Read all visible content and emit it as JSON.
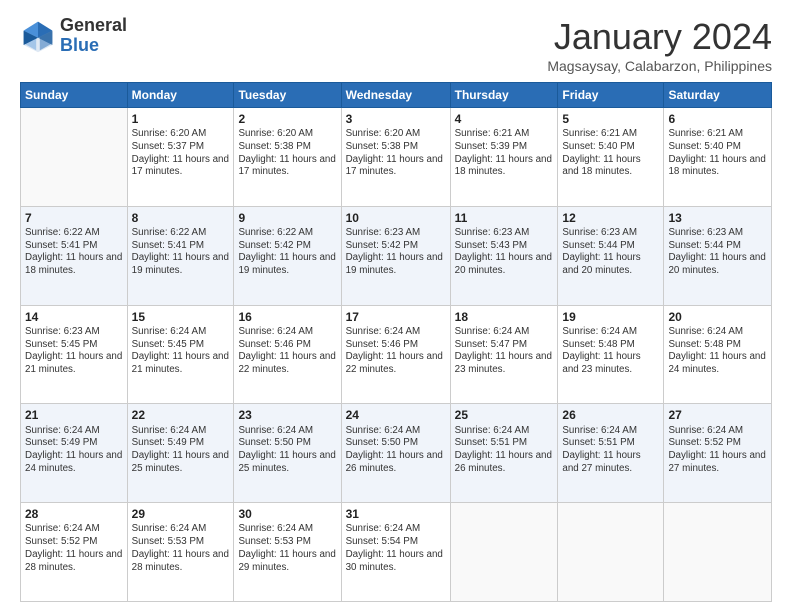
{
  "logo": {
    "general": "General",
    "blue": "Blue"
  },
  "title": "January 2024",
  "location": "Magsaysay, Calabarzon, Philippines",
  "days_header": [
    "Sunday",
    "Monday",
    "Tuesday",
    "Wednesday",
    "Thursday",
    "Friday",
    "Saturday"
  ],
  "weeks": [
    [
      {
        "day": "",
        "sunrise": "",
        "sunset": "",
        "daylight": ""
      },
      {
        "day": "1",
        "sunrise": "Sunrise: 6:20 AM",
        "sunset": "Sunset: 5:37 PM",
        "daylight": "Daylight: 11 hours and 17 minutes."
      },
      {
        "day": "2",
        "sunrise": "Sunrise: 6:20 AM",
        "sunset": "Sunset: 5:38 PM",
        "daylight": "Daylight: 11 hours and 17 minutes."
      },
      {
        "day": "3",
        "sunrise": "Sunrise: 6:20 AM",
        "sunset": "Sunset: 5:38 PM",
        "daylight": "Daylight: 11 hours and 17 minutes."
      },
      {
        "day": "4",
        "sunrise": "Sunrise: 6:21 AM",
        "sunset": "Sunset: 5:39 PM",
        "daylight": "Daylight: 11 hours and 18 minutes."
      },
      {
        "day": "5",
        "sunrise": "Sunrise: 6:21 AM",
        "sunset": "Sunset: 5:40 PM",
        "daylight": "Daylight: 11 hours and 18 minutes."
      },
      {
        "day": "6",
        "sunrise": "Sunrise: 6:21 AM",
        "sunset": "Sunset: 5:40 PM",
        "daylight": "Daylight: 11 hours and 18 minutes."
      }
    ],
    [
      {
        "day": "7",
        "sunrise": "Sunrise: 6:22 AM",
        "sunset": "Sunset: 5:41 PM",
        "daylight": "Daylight: 11 hours and 18 minutes."
      },
      {
        "day": "8",
        "sunrise": "Sunrise: 6:22 AM",
        "sunset": "Sunset: 5:41 PM",
        "daylight": "Daylight: 11 hours and 19 minutes."
      },
      {
        "day": "9",
        "sunrise": "Sunrise: 6:22 AM",
        "sunset": "Sunset: 5:42 PM",
        "daylight": "Daylight: 11 hours and 19 minutes."
      },
      {
        "day": "10",
        "sunrise": "Sunrise: 6:23 AM",
        "sunset": "Sunset: 5:42 PM",
        "daylight": "Daylight: 11 hours and 19 minutes."
      },
      {
        "day": "11",
        "sunrise": "Sunrise: 6:23 AM",
        "sunset": "Sunset: 5:43 PM",
        "daylight": "Daylight: 11 hours and 20 minutes."
      },
      {
        "day": "12",
        "sunrise": "Sunrise: 6:23 AM",
        "sunset": "Sunset: 5:44 PM",
        "daylight": "Daylight: 11 hours and 20 minutes."
      },
      {
        "day": "13",
        "sunrise": "Sunrise: 6:23 AM",
        "sunset": "Sunset: 5:44 PM",
        "daylight": "Daylight: 11 hours and 20 minutes."
      }
    ],
    [
      {
        "day": "14",
        "sunrise": "Sunrise: 6:23 AM",
        "sunset": "Sunset: 5:45 PM",
        "daylight": "Daylight: 11 hours and 21 minutes."
      },
      {
        "day": "15",
        "sunrise": "Sunrise: 6:24 AM",
        "sunset": "Sunset: 5:45 PM",
        "daylight": "Daylight: 11 hours and 21 minutes."
      },
      {
        "day": "16",
        "sunrise": "Sunrise: 6:24 AM",
        "sunset": "Sunset: 5:46 PM",
        "daylight": "Daylight: 11 hours and 22 minutes."
      },
      {
        "day": "17",
        "sunrise": "Sunrise: 6:24 AM",
        "sunset": "Sunset: 5:46 PM",
        "daylight": "Daylight: 11 hours and 22 minutes."
      },
      {
        "day": "18",
        "sunrise": "Sunrise: 6:24 AM",
        "sunset": "Sunset: 5:47 PM",
        "daylight": "Daylight: 11 hours and 23 minutes."
      },
      {
        "day": "19",
        "sunrise": "Sunrise: 6:24 AM",
        "sunset": "Sunset: 5:48 PM",
        "daylight": "Daylight: 11 hours and 23 minutes."
      },
      {
        "day": "20",
        "sunrise": "Sunrise: 6:24 AM",
        "sunset": "Sunset: 5:48 PM",
        "daylight": "Daylight: 11 hours and 24 minutes."
      }
    ],
    [
      {
        "day": "21",
        "sunrise": "Sunrise: 6:24 AM",
        "sunset": "Sunset: 5:49 PM",
        "daylight": "Daylight: 11 hours and 24 minutes."
      },
      {
        "day": "22",
        "sunrise": "Sunrise: 6:24 AM",
        "sunset": "Sunset: 5:49 PM",
        "daylight": "Daylight: 11 hours and 25 minutes."
      },
      {
        "day": "23",
        "sunrise": "Sunrise: 6:24 AM",
        "sunset": "Sunset: 5:50 PM",
        "daylight": "Daylight: 11 hours and 25 minutes."
      },
      {
        "day": "24",
        "sunrise": "Sunrise: 6:24 AM",
        "sunset": "Sunset: 5:50 PM",
        "daylight": "Daylight: 11 hours and 26 minutes."
      },
      {
        "day": "25",
        "sunrise": "Sunrise: 6:24 AM",
        "sunset": "Sunset: 5:51 PM",
        "daylight": "Daylight: 11 hours and 26 minutes."
      },
      {
        "day": "26",
        "sunrise": "Sunrise: 6:24 AM",
        "sunset": "Sunset: 5:51 PM",
        "daylight": "Daylight: 11 hours and 27 minutes."
      },
      {
        "day": "27",
        "sunrise": "Sunrise: 6:24 AM",
        "sunset": "Sunset: 5:52 PM",
        "daylight": "Daylight: 11 hours and 27 minutes."
      }
    ],
    [
      {
        "day": "28",
        "sunrise": "Sunrise: 6:24 AM",
        "sunset": "Sunset: 5:52 PM",
        "daylight": "Daylight: 11 hours and 28 minutes."
      },
      {
        "day": "29",
        "sunrise": "Sunrise: 6:24 AM",
        "sunset": "Sunset: 5:53 PM",
        "daylight": "Daylight: 11 hours and 28 minutes."
      },
      {
        "day": "30",
        "sunrise": "Sunrise: 6:24 AM",
        "sunset": "Sunset: 5:53 PM",
        "daylight": "Daylight: 11 hours and 29 minutes."
      },
      {
        "day": "31",
        "sunrise": "Sunrise: 6:24 AM",
        "sunset": "Sunset: 5:54 PM",
        "daylight": "Daylight: 11 hours and 30 minutes."
      },
      {
        "day": "",
        "sunrise": "",
        "sunset": "",
        "daylight": ""
      },
      {
        "day": "",
        "sunrise": "",
        "sunset": "",
        "daylight": ""
      },
      {
        "day": "",
        "sunrise": "",
        "sunset": "",
        "daylight": ""
      }
    ]
  ]
}
